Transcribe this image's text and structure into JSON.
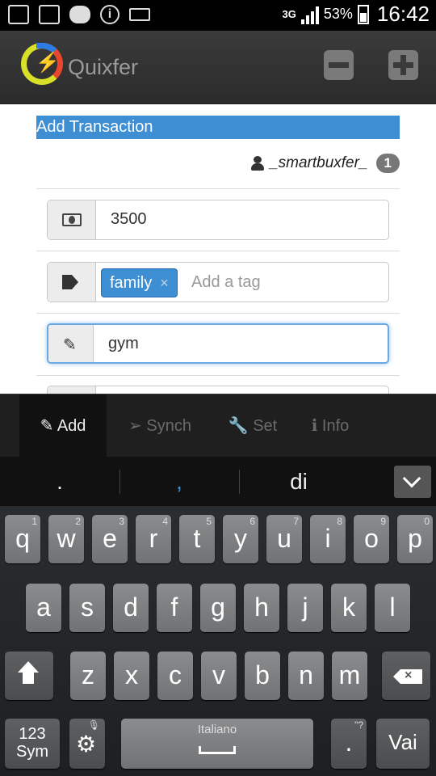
{
  "status_bar": {
    "network": "3G",
    "battery": "53%",
    "time": "16:42"
  },
  "app": {
    "title": "Quixfer"
  },
  "form": {
    "title": "Add Transaction",
    "user_name": "_smartbuxfer_",
    "user_badge": "1",
    "amount_value": "3500",
    "tags": [
      "family"
    ],
    "tag_remove_glyph": "×",
    "tag_placeholder": "Add a tag",
    "description_value": "gym"
  },
  "tabs": [
    {
      "label": "Add",
      "icon": "edit-icon",
      "active": true
    },
    {
      "label": "Synch",
      "icon": "send-icon",
      "active": false
    },
    {
      "label": "Set",
      "icon": "wrench-icon",
      "active": false
    },
    {
      "label": "Info",
      "icon": "info-icon",
      "active": false
    }
  ],
  "keyboard": {
    "suggestions": [
      ".",
      ",",
      "di"
    ],
    "row1": [
      {
        "key": "q",
        "alt": "1"
      },
      {
        "key": "w",
        "alt": "2"
      },
      {
        "key": "e",
        "alt": "3"
      },
      {
        "key": "r",
        "alt": "4"
      },
      {
        "key": "t",
        "alt": "5"
      },
      {
        "key": "y",
        "alt": "6"
      },
      {
        "key": "u",
        "alt": "7"
      },
      {
        "key": "i",
        "alt": "8"
      },
      {
        "key": "o",
        "alt": "9"
      },
      {
        "key": "p",
        "alt": "0"
      }
    ],
    "row2": [
      "a",
      "s",
      "d",
      "f",
      "g",
      "h",
      "j",
      "k",
      "l"
    ],
    "row3": [
      "z",
      "x",
      "c",
      "v",
      "b",
      "n",
      "m"
    ],
    "sym_label_1": "123",
    "sym_label_2": "Sym",
    "space_label": "Italiano",
    "period_key": ".",
    "period_alt": "\"?",
    "enter_label": "Vai"
  },
  "colors": {
    "accent": "#3d8ed3",
    "header_bg": "#333333",
    "keyboard_bg": "#25282a"
  }
}
